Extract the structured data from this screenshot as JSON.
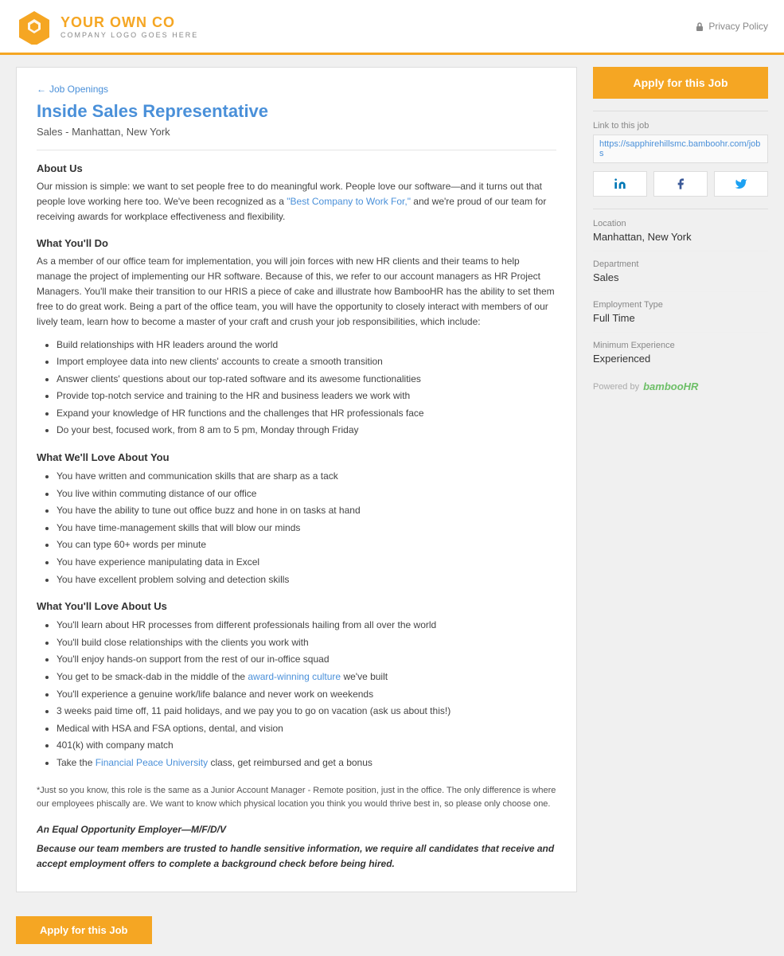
{
  "header": {
    "logo_name_part1": "YOUR ",
    "logo_name_part2": "OWN",
    "logo_name_part3": " CO",
    "logo_tagline": "COMPANY LOGO GOES HERE",
    "privacy_label": "Privacy Policy"
  },
  "breadcrumb": {
    "arrow": "←",
    "link_text": "Job Openings"
  },
  "job": {
    "title": "Inside Sales Representative",
    "subtitle": "Sales - Manhattan, New York"
  },
  "content": {
    "about_title": "About Us",
    "about_text": "Our mission is simple: we want to set people free to do meaningful work. People love our software—and it turns out that people love working here too. We've been recognized as a ",
    "about_link": "\"Best Company to Work For,\"",
    "about_text2": " and we're proud of our team for receiving awards for workplace effectiveness and flexibility.",
    "what_you_do_title": "What You'll Do",
    "what_you_do_text": "As a member of our office team for implementation, you will join forces with new HR clients and their teams to help manage the project of implementing our HR software. Because of this, we refer to our account managers as HR Project Managers. You'll make their transition to our HRIS a piece of cake and illustrate how BambooHR has the ability to set them free to do great work. Being a part of the office team, you will have the opportunity to closely interact with members of our lively team, learn how to become a master of your craft and crush your job responsibilities, which include:",
    "what_you_do_bullets": [
      "Build relationships with HR leaders around the world",
      "Import employee data into new clients' accounts to create a smooth transition",
      "Answer clients' questions about our top-rated software and its awesome functionalities",
      "Provide top-notch service and training to the HR and business leaders we work with",
      "Expand your knowledge of HR functions and the challenges that HR professionals face",
      "Do your best, focused work, from 8 am to 5 pm, Monday through Friday"
    ],
    "love_about_you_title": "What We'll Love About You",
    "love_about_you_bullets": [
      "You have written and communication skills that are sharp as a tack",
      "You live within commuting distance of our office",
      "You have the ability to tune out office buzz and hone in on tasks at hand",
      "You have time-management skills that will blow our minds",
      "You can type 60+ words per minute",
      "You have experience manipulating data in Excel",
      "You have excellent problem solving and detection skills"
    ],
    "love_about_us_title": "What You'll Love About Us",
    "love_about_us_bullets_pre": [
      "You'll learn about HR processes from different professionals hailing from all over the world",
      "You'll build close relationships with the clients you work with",
      "You'll enjoy hands-on support from the rest of our in-office squad",
      "You get to be smack-dab in the middle of the "
    ],
    "love_about_us_link": "award-winning culture",
    "love_about_us_after_link": " we've built",
    "love_about_us_bullets": [
      "You'll experience a genuine work/life balance and never work on weekends",
      "3 weeks paid time off, 11 paid holidays, and we pay you to go on vacation (ask us about this!)",
      "Medical with HSA and FSA options, dental, and vision",
      "401(k) with company match",
      "Take the "
    ],
    "financial_peace_link": "Financial Peace University",
    "financial_peace_after": " class, get reimbursed and get a bonus",
    "disclaimer": "*Just so you know, this role is the same as a Junior Account Manager - Remote position, just in the office. The only difference is where our employees phiscally are. We want to know which physical location you think you would thrive best in, so please only choose one.",
    "equal_opp": "An Equal Opportunity Employer—M/F/D/V",
    "background_check": "Because our team members are trusted to handle sensitive information, we require all candidates that receive and accept employment offers to complete a background check before being hired."
  },
  "sidebar": {
    "apply_button": "Apply for this Job",
    "link_label": "Link to this job",
    "link_url": "https://sapphirehillsmc.bamboohr.com/jobs",
    "location_label": "Location",
    "location_value": "Manhattan, New York",
    "department_label": "Department",
    "department_value": "Sales",
    "employment_type_label": "Employment Type",
    "employment_type_value": "Full Time",
    "min_experience_label": "Minimum Experience",
    "min_experience_value": "Experienced",
    "powered_by": "Powered by",
    "powered_by_brand": "bambooHR"
  },
  "bottom": {
    "apply_button": "Apply for this Job"
  }
}
